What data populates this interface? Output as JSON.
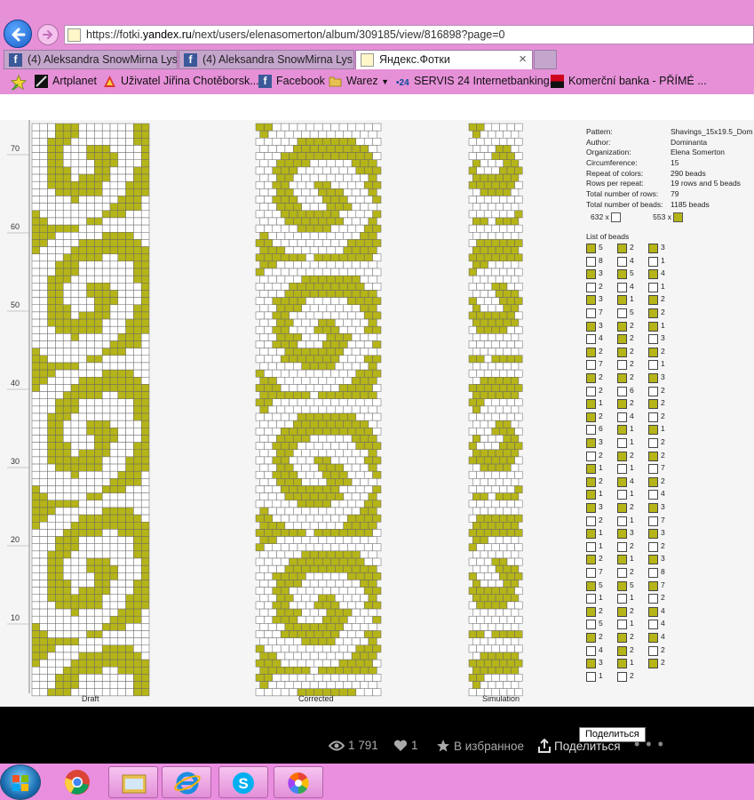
{
  "browser": {
    "url_prefix": "https://fotki.",
    "url_domain": "yandex.ru",
    "url_path": "/next/users/elenasomerton/album/309185/view/816898?page=0",
    "tabs": [
      {
        "label": "(4) Aleksandra SnowMirna Lys...",
        "icon": "facebook-icon",
        "active": false
      },
      {
        "label": "(4) Aleksandra SnowMirna Lys...",
        "icon": "facebook-icon",
        "active": false
      },
      {
        "label": "Яндекс.Фотки",
        "icon": "yandex-fotki-icon",
        "active": true
      }
    ],
    "tab_close": "×",
    "favorites": [
      {
        "label": "Artplanet",
        "icon": "artplanet-icon"
      },
      {
        "label": "Uživatel Jiřina Chotěborsk...",
        "icon": "user-icon"
      },
      {
        "label": "Facebook",
        "icon": "facebook-icon"
      },
      {
        "label": "Warez",
        "icon": "folder-icon"
      },
      {
        "label": "SERVIS 24 Internetbanking...",
        "icon": "servis24-icon"
      },
      {
        "label": "Komerční banka - PŘÍMÉ ...",
        "icon": "kb-icon"
      }
    ]
  },
  "pattern": {
    "axis_ticks": [
      "70",
      "60",
      "50",
      "40",
      "30",
      "20",
      "10"
    ],
    "captions": {
      "draft": "Draft",
      "corrected": "Corrected",
      "simulation": "Simulation"
    },
    "info": [
      {
        "key": "Pattern:",
        "value": "Shavings_15x19.5_Dom"
      },
      {
        "key": "Author:",
        "value": "Dominanta"
      },
      {
        "key": "Organization:",
        "value": "Elena Somerton"
      },
      {
        "key": "Circumference:",
        "value": "15"
      },
      {
        "key": "Repeat of colors:",
        "value": "290 beads"
      },
      {
        "key": "Rows per repeat:",
        "value": "19 rows and 5 beads"
      },
      {
        "key": "Total number of rows:",
        "value": "79"
      },
      {
        "key": "Total number of beads:",
        "value": "1185 beads"
      }
    ],
    "white_count": "632 x",
    "olive_count": "553 x",
    "list_title": "List of beads",
    "colors": {
      "olive": "#b5b418",
      "white": "#ffffff",
      "grid": "#555555"
    },
    "bead_list": [
      [
        [
          "o",
          "5"
        ],
        [
          "w",
          "8"
        ],
        [
          "o",
          "3"
        ],
        [
          "w",
          "2"
        ],
        [
          "o",
          "3"
        ],
        [
          "w",
          "7"
        ],
        [
          "o",
          "3"
        ],
        [
          "w",
          "4"
        ],
        [
          "o",
          "2"
        ],
        [
          "w",
          "7"
        ],
        [
          "o",
          "2"
        ],
        [
          "w",
          "2"
        ],
        [
          "o",
          "1"
        ],
        [
          "o",
          "2"
        ],
        [
          "w",
          "6"
        ],
        [
          "o",
          "3"
        ],
        [
          "w",
          "2"
        ],
        [
          "o",
          "1"
        ],
        [
          "o",
          "2"
        ],
        [
          "o",
          "1"
        ],
        [
          "o",
          "3"
        ],
        [
          "w",
          "2"
        ],
        [
          "o",
          "1"
        ],
        [
          "w",
          "1"
        ],
        [
          "o",
          "2"
        ],
        [
          "w",
          "7"
        ],
        [
          "o",
          "5"
        ],
        [
          "w",
          "1"
        ],
        [
          "o",
          "2"
        ],
        [
          "w",
          "5"
        ],
        [
          "o",
          "2"
        ],
        [
          "w",
          "4"
        ],
        [
          "o",
          "3"
        ],
        [
          "w",
          "1"
        ]
      ],
      [
        [
          "o",
          "2"
        ],
        [
          "w",
          "4"
        ],
        [
          "o",
          "5"
        ],
        [
          "w",
          "4"
        ],
        [
          "o",
          "1"
        ],
        [
          "w",
          "5"
        ],
        [
          "o",
          "2"
        ],
        [
          "o",
          "2"
        ],
        [
          "o",
          "2"
        ],
        [
          "w",
          "2"
        ],
        [
          "o",
          "2"
        ],
        [
          "w",
          "6"
        ],
        [
          "o",
          "2"
        ],
        [
          "w",
          "4"
        ],
        [
          "o",
          "1"
        ],
        [
          "w",
          "1"
        ],
        [
          "o",
          "2"
        ],
        [
          "w",
          "1"
        ],
        [
          "o",
          "4"
        ],
        [
          "w",
          "1"
        ],
        [
          "o",
          "2"
        ],
        [
          "w",
          "1"
        ],
        [
          "o",
          "3"
        ],
        [
          "w",
          "2"
        ],
        [
          "o",
          "1"
        ],
        [
          "w",
          "2"
        ],
        [
          "o",
          "5"
        ],
        [
          "w",
          "1"
        ],
        [
          "o",
          "2"
        ],
        [
          "w",
          "1"
        ],
        [
          "o",
          "2"
        ],
        [
          "o",
          "2"
        ],
        [
          "o",
          "1"
        ],
        [
          "w",
          "2"
        ]
      ],
      [
        [
          "o",
          "3"
        ],
        [
          "w",
          "1"
        ],
        [
          "o",
          "4"
        ],
        [
          "w",
          "1"
        ],
        [
          "o",
          "2"
        ],
        [
          "o",
          "2"
        ],
        [
          "o",
          "1"
        ],
        [
          "w",
          "3"
        ],
        [
          "o",
          "2"
        ],
        [
          "w",
          "1"
        ],
        [
          "o",
          "3"
        ],
        [
          "w",
          "2"
        ],
        [
          "o",
          "2"
        ],
        [
          "w",
          "2"
        ],
        [
          "o",
          "1"
        ],
        [
          "w",
          "2"
        ],
        [
          "o",
          "2"
        ],
        [
          "w",
          "7"
        ],
        [
          "o",
          "2"
        ],
        [
          "w",
          "4"
        ],
        [
          "o",
          "3"
        ],
        [
          "w",
          "7"
        ],
        [
          "o",
          "3"
        ],
        [
          "w",
          "2"
        ],
        [
          "o",
          "3"
        ],
        [
          "w",
          "8"
        ],
        [
          "o",
          "7"
        ],
        [
          "w",
          "2"
        ],
        [
          "o",
          "4"
        ],
        [
          "w",
          "4"
        ],
        [
          "o",
          "4"
        ],
        [
          "w",
          "2"
        ],
        [
          "o",
          "2"
        ]
      ]
    ]
  },
  "photo_stats": {
    "views": "1 791",
    "likes": "1",
    "favorites_label": "В избранное",
    "share_label": "Поделиться",
    "tooltip": "Поделиться",
    "more": "• • •"
  },
  "taskbar": {
    "apps": [
      "chrome-icon",
      "file-explorer-icon",
      "internet-explorer-icon",
      "skype-icon",
      "picasa-icon"
    ]
  }
}
